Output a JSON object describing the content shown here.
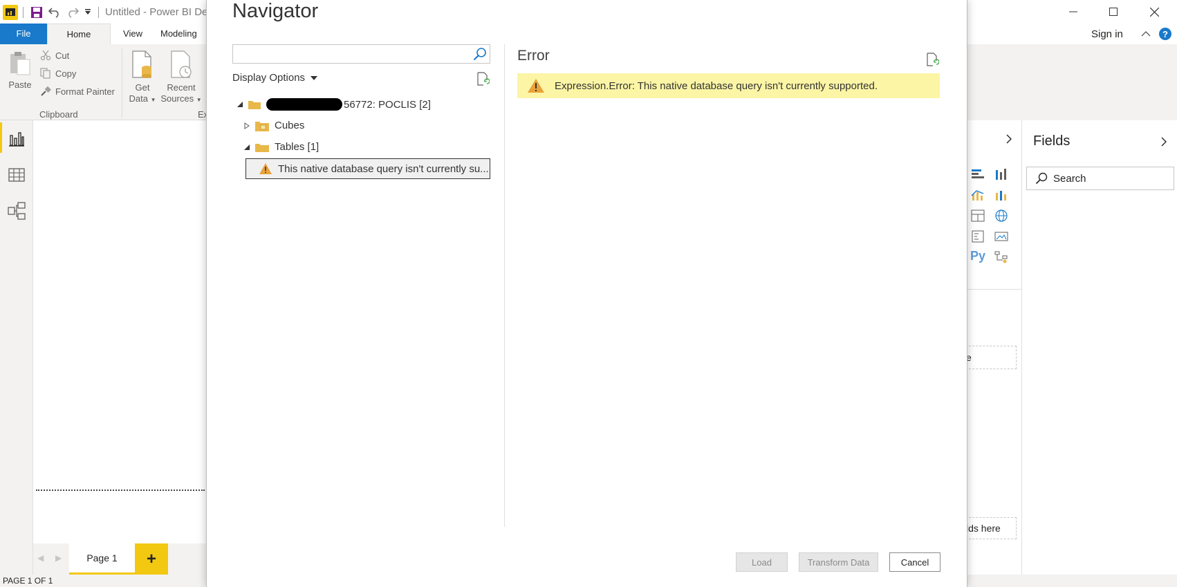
{
  "window": {
    "title": "Untitled - Power BI De",
    "sign_in": "Sign in",
    "help": "?"
  },
  "ribbon": {
    "tabs": [
      "File",
      "Home",
      "View",
      "Modeling"
    ],
    "paste": "Paste",
    "cut": "Cut",
    "copy": "Copy",
    "format_painter": "Format Painter",
    "clipboard_group": "Clipboard",
    "get_data": [
      "Get",
      "Data"
    ],
    "recent_sources": [
      "Recent",
      "Sources"
    ],
    "cut_group_label": "Ex"
  },
  "pages": {
    "page1": "Page 1",
    "add": "+",
    "status": "PAGE 1 OF 1"
  },
  "fields_pane": {
    "title": "Fields",
    "search_placeholder": "Search",
    "drop_label_1": "e",
    "drop_label_2": "lds here",
    "py_label": "Py"
  },
  "navigator": {
    "title": "Navigator",
    "search_value": "",
    "display_options": "Display Options",
    "tree": {
      "root_label": "56772: POCLIS [2]",
      "cubes": "Cubes",
      "tables": "Tables [1]",
      "selected_item": "This native database query isn't currently su..."
    },
    "error_title": "Error",
    "error_message": "Expression.Error: This native database query isn't currently supported.",
    "buttons": {
      "load": "Load",
      "transform": "Transform Data",
      "cancel": "Cancel"
    }
  }
}
